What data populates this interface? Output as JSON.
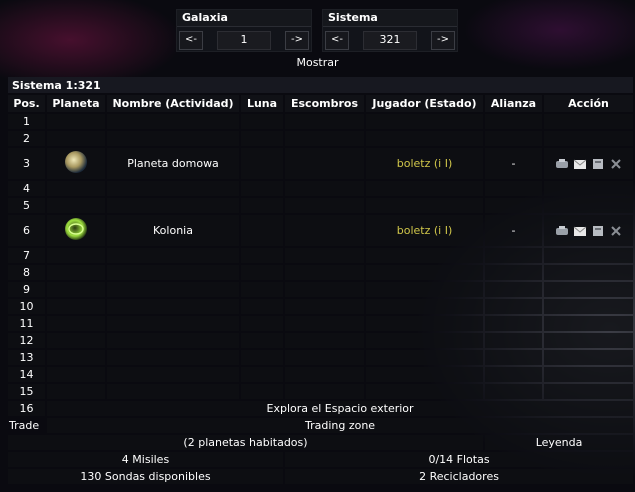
{
  "galaxy_nav": {
    "title": "Galaxia",
    "prev": "<-",
    "value": "1",
    "next": "->"
  },
  "system_nav": {
    "title": "Sistema",
    "prev": "<-",
    "value": "321",
    "next": "->"
  },
  "show_button": "Mostrar",
  "table": {
    "title": "Sistema 1:321",
    "headers": [
      "Pos.",
      "Planeta",
      "Nombre (Actividad)",
      "Luna",
      "Escombros",
      "Jugador (Estado)",
      "Alianza",
      "Acción"
    ],
    "rows": [
      {
        "pos": "1"
      },
      {
        "pos": "2"
      },
      {
        "pos": "3",
        "planet_icon": "desert-planet-icon",
        "name": "Planeta domowa",
        "player": "boletz",
        "status": "(i I)",
        "alliance": "-"
      },
      {
        "pos": "4"
      },
      {
        "pos": "5"
      },
      {
        "pos": "6",
        "planet_icon": "green-planet-icon",
        "name": "Kolonia",
        "player": "boletz",
        "status": "(i I)",
        "alliance": "-"
      },
      {
        "pos": "7"
      },
      {
        "pos": "8"
      },
      {
        "pos": "9"
      },
      {
        "pos": "10"
      },
      {
        "pos": "11"
      },
      {
        "pos": "12"
      },
      {
        "pos": "13"
      },
      {
        "pos": "14"
      },
      {
        "pos": "15"
      }
    ],
    "row16": {
      "pos": "16",
      "text": "Explora el Espacio exterior"
    },
    "trade": {
      "label": "Trade",
      "text": "Trading zone"
    },
    "footer": {
      "planets": "(2 planetas habitados)",
      "legend": "Leyenda",
      "missiles": "4 Misiles",
      "fleets": "0/14 Flotas",
      "probes": "130 Sondas disponibles",
      "recyclers": "2 Recicladores"
    }
  }
}
